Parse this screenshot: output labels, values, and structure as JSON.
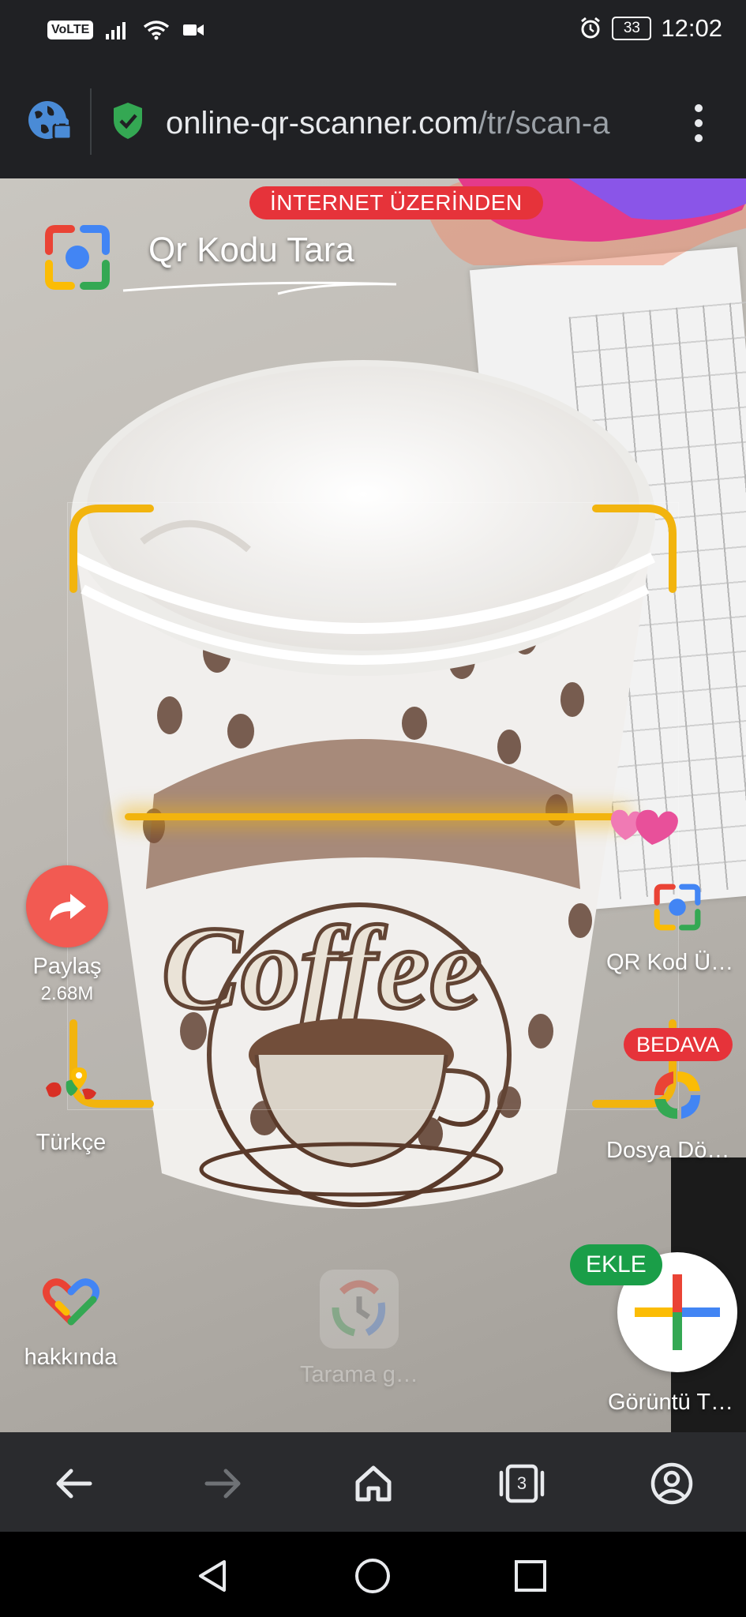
{
  "status_bar": {
    "volte": "VoLTE",
    "battery": "33",
    "time": "12:02"
  },
  "browser": {
    "url_domain": "online-qr-scanner.com",
    "url_path": "/tr/scan-a",
    "tab_count": "3"
  },
  "page": {
    "badge_internet": "İNTERNET ÜZERİNDEN",
    "title": "Qr Kodu Tara",
    "left_actions": [
      {
        "label": "Paylaş",
        "sub": "2.68M"
      },
      {
        "label": "Türkçe"
      },
      {
        "label": "hakkında"
      }
    ],
    "right_actions": [
      {
        "label": "QR Kod Ü…"
      },
      {
        "label": "Dosya Dö…",
        "badge": "BEDAVA"
      },
      {
        "label": "Görüntü T…",
        "badge": "EKLE"
      }
    ],
    "ghost_label": "Tarama g…"
  },
  "colors": {
    "scan_accent": "#f2b40e",
    "badge_red": "#e6333a",
    "badge_green": "#1a9e48",
    "share_red": "#f25a52"
  }
}
